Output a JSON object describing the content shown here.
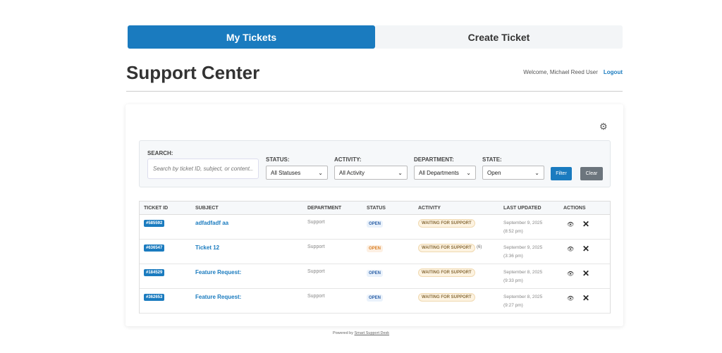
{
  "tabs": [
    {
      "label": "My Tickets",
      "active": true
    },
    {
      "label": "Create Ticket",
      "active": false
    }
  ],
  "header": {
    "title": "Support Center",
    "welcome": "Welcome, Michael Reed User",
    "logout": "Logout"
  },
  "filters": {
    "search_label": "SEARCH:",
    "search_placeholder": "Search by ticket ID, subject, or content...",
    "status_label": "STATUS:",
    "status_value": "All Statuses",
    "activity_label": "ACTIVITY:",
    "activity_value": "All Activity",
    "department_label": "DEPARTMENT:",
    "department_value": "All Departments",
    "state_label": "STATE:",
    "state_value": "Open",
    "filter_button": "Filter",
    "clear_button": "Clear"
  },
  "colors": {
    "primary": "#1a7bbf",
    "clear": "#6c757d"
  },
  "table": {
    "headers": [
      "TICKET ID",
      "SUBJECT",
      "DEPARTMENT",
      "STATUS",
      "ACTIVITY",
      "LAST UPDATED",
      "ACTIONS"
    ],
    "rows": [
      {
        "id": "#585592",
        "subject": "adfadfadf aa",
        "department": "Support",
        "status": "OPEN",
        "status_color": "blue",
        "activity": "WAITING FOR SUPPORT",
        "count": "",
        "date": "September 9, 2025",
        "time": "(8:52 pm)"
      },
      {
        "id": "#636547",
        "subject": "Ticket 12",
        "department": "Support",
        "status": "OPEN",
        "status_color": "orange",
        "activity": "WAITING FOR SUPPORT",
        "count": "(6)",
        "date": "September 9, 2025",
        "time": "(3:36 pm)"
      },
      {
        "id": "#184529",
        "subject": "Feature Request:",
        "department": "Support",
        "status": "OPEN",
        "status_color": "blue",
        "activity": "WAITING FOR SUPPORT",
        "count": "",
        "date": "September 8, 2025",
        "time": "(9:33 pm)"
      },
      {
        "id": "#362653",
        "subject": "Feature Request:",
        "department": "Support",
        "status": "OPEN",
        "status_color": "blue",
        "activity": "WAITING FOR SUPPORT",
        "count": "",
        "date": "September 8, 2025",
        "time": "(9:27 pm)"
      }
    ]
  },
  "footer": {
    "prefix": "Powered by",
    "link": "Smart Support Desk"
  }
}
